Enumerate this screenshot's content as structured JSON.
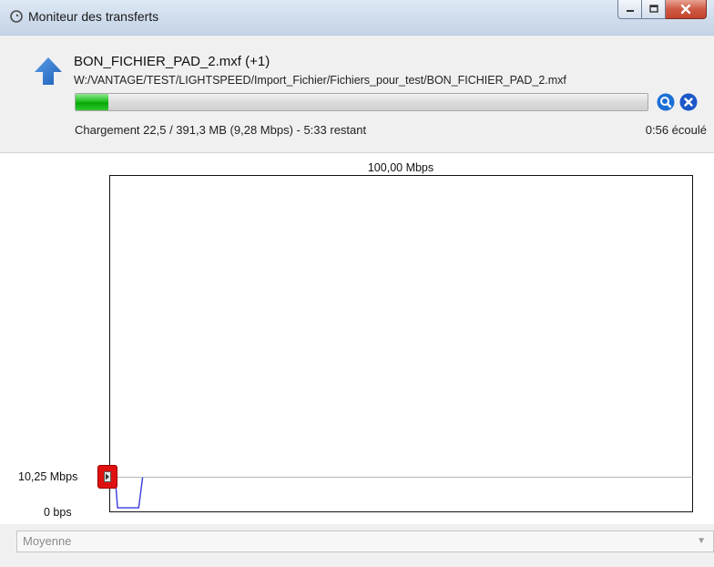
{
  "window": {
    "title": "Moniteur des transferts",
    "icon": "refresh-icon",
    "controls": [
      "minimize-icon",
      "maximize-icon",
      "close-icon"
    ]
  },
  "transfer": {
    "file_name": "BON_FICHIER_PAD_2.mxf (+1)",
    "path": "W:/VANTAGE/TEST/LIGHTSPEED/Import_Fichier/Fichiers_pour_test/BON_FICHIER_PAD_2.mxf",
    "progress_fraction": 0.0575,
    "status": "Chargement 22,5 / 391,3 MB (9,28 Mbps) - 5:33 restant",
    "elapsed": "0:56 écoulé",
    "direction_icon": "upload-arrow-icon",
    "action_icons": [
      "magnifier-icon",
      "cancel-icon"
    ]
  },
  "graph": {
    "max_label": "100,00 Mbps",
    "current_label": "10,25 Mbps",
    "min_label": "0 bps",
    "marker_icon": "play-marker-icon"
  },
  "chart_data": {
    "type": "line",
    "title": "",
    "xlabel": "",
    "ylabel": "",
    "ylim": [
      0,
      100
    ],
    "reference_line": 10.25,
    "series": [
      {
        "values": [
          10.25,
          1.2,
          1.2,
          1.2,
          1.2,
          10.25
        ]
      }
    ]
  },
  "footer": {
    "average_select": "Moyenne"
  },
  "colors": {
    "progress": "#17b317",
    "series_line": "#3a3ae0",
    "marker": "#e01010",
    "search_button": "#1c6fd6",
    "close_button": "#1c57c9"
  }
}
